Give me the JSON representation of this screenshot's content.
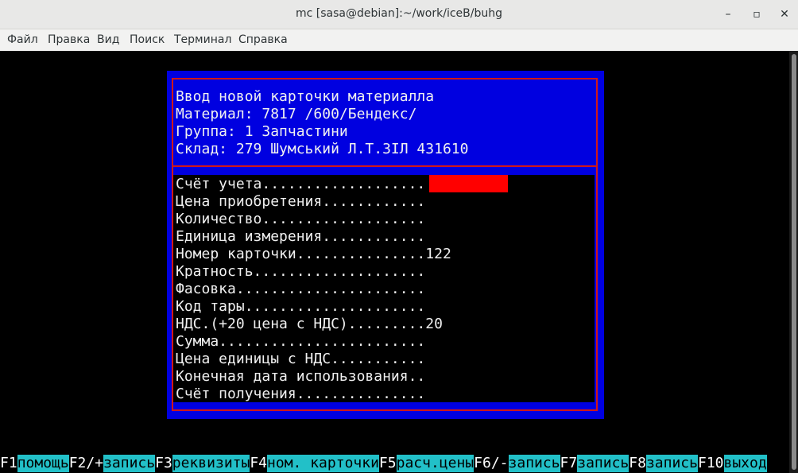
{
  "window": {
    "title": "mc [sasa@debian]:~/work/iceB/buhg",
    "minimize_glyph": "–",
    "maximize_glyph": "▫",
    "close_glyph": "✕"
  },
  "menu": {
    "items": [
      "Файл",
      "Правка",
      "Вид",
      "Поиск",
      "Терминал",
      "Справка"
    ]
  },
  "dialog": {
    "header": [
      "Ввод новой карточки материалла",
      "Материал: 7817 /600/Бендекс/",
      "Группа: 1 Запчастини",
      "Склад: 279 Шумський Л.Т.ЗIЛ 431610"
    ],
    "fields": [
      {
        "label": "Счёт учета...................",
        "value": ""
      },
      {
        "label": "Цена приобретения............",
        "value": ""
      },
      {
        "label": "Количество...................",
        "value": ""
      },
      {
        "label": "Единица измерения............",
        "value": ""
      },
      {
        "label": "Номер карточки...............",
        "value": "122"
      },
      {
        "label": "Кратность....................",
        "value": ""
      },
      {
        "label": "Фасовка......................",
        "value": ""
      },
      {
        "label": "Код тары.....................",
        "value": ""
      },
      {
        "label": "НДС.(+20 цена с НДС).........",
        "value": "20"
      },
      {
        "label": "Сумма........................",
        "value": ""
      },
      {
        "label": "Цена единицы с НДС...........",
        "value": ""
      },
      {
        "label": "Конечная дата использования..",
        "value": ""
      },
      {
        "label": "Счёт получения...............",
        "value": ""
      }
    ],
    "colors": {
      "frame": "#0000e0",
      "border": "#d01818",
      "cursor": "#ff0000"
    }
  },
  "fkeys": [
    {
      "key": "F1",
      "label": "помощь"
    },
    {
      "key": "F2/+",
      "label": "запись"
    },
    {
      "key": "F3",
      "label": "реквизиты"
    },
    {
      "key": "F4",
      "label": "ном. карточки"
    },
    {
      "key": "F5",
      "label": "расч.цены"
    },
    {
      "key": "F6/-",
      "label": "запись"
    },
    {
      "key": "F7",
      "label": "запись"
    },
    {
      "key": "F8",
      "label": "запись"
    },
    {
      "key": "F10",
      "label": "выход"
    }
  ]
}
